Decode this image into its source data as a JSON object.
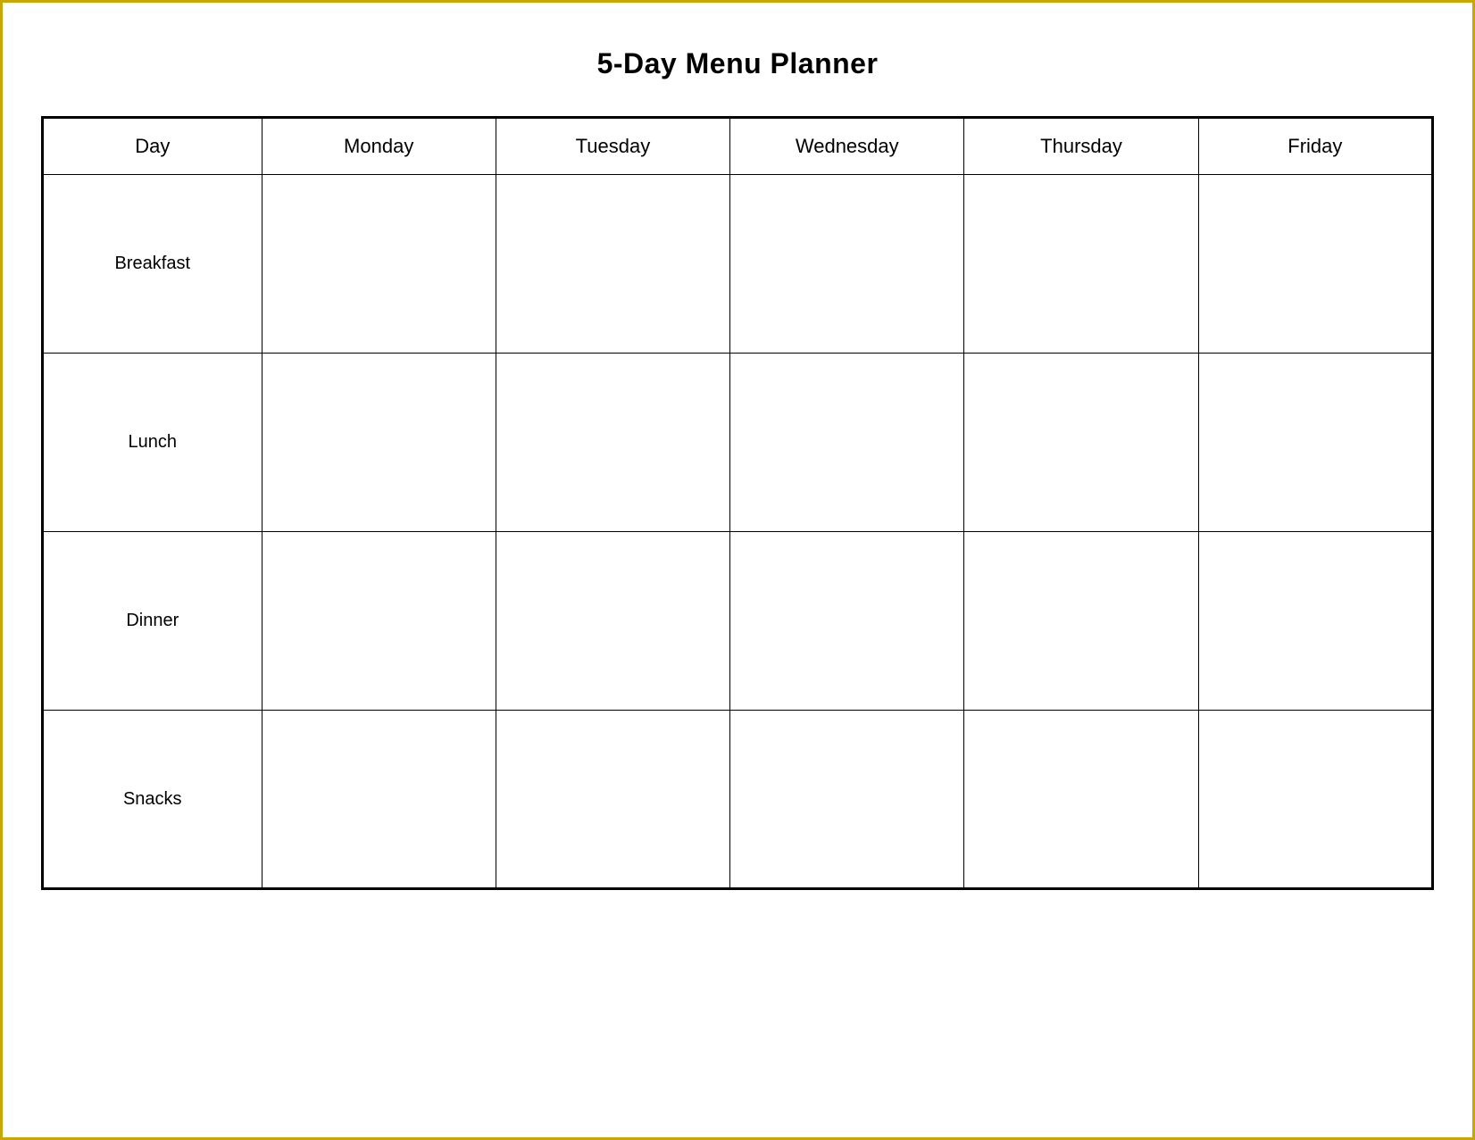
{
  "page": {
    "title": "5-Day Menu Planner",
    "border_color": "#c8a800"
  },
  "table": {
    "headers": [
      {
        "id": "day",
        "label": "Day"
      },
      {
        "id": "monday",
        "label": "Monday"
      },
      {
        "id": "tuesday",
        "label": "Tuesday"
      },
      {
        "id": "wednesday",
        "label": "Wednesday"
      },
      {
        "id": "thursday",
        "label": "Thursday"
      },
      {
        "id": "friday",
        "label": "Friday"
      }
    ],
    "rows": [
      {
        "id": "breakfast",
        "label": "Breakfast"
      },
      {
        "id": "lunch",
        "label": "Lunch"
      },
      {
        "id": "dinner",
        "label": "Dinner"
      },
      {
        "id": "snacks",
        "label": "Snacks"
      }
    ]
  }
}
